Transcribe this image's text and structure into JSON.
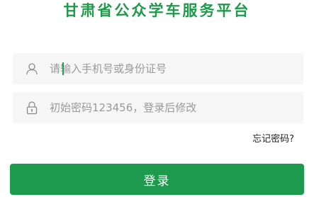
{
  "app": {
    "title": "甘肃省公众学车服务平台"
  },
  "login_form": {
    "phone_placeholder": "请输入手机号或身份证号",
    "phone_value": "",
    "password_placeholder": "初始密码123456，登录后修改",
    "password_value": "",
    "forgot_label": "忘记密码?",
    "login_label": "登录"
  },
  "icons": {
    "user": "user-icon",
    "lock": "lock-icon"
  },
  "colors": {
    "brand_green": "#1d9a4d",
    "title_green": "#1f9a4a",
    "field_bg": "#f6f6f6",
    "placeholder": "#9a9a9a"
  }
}
